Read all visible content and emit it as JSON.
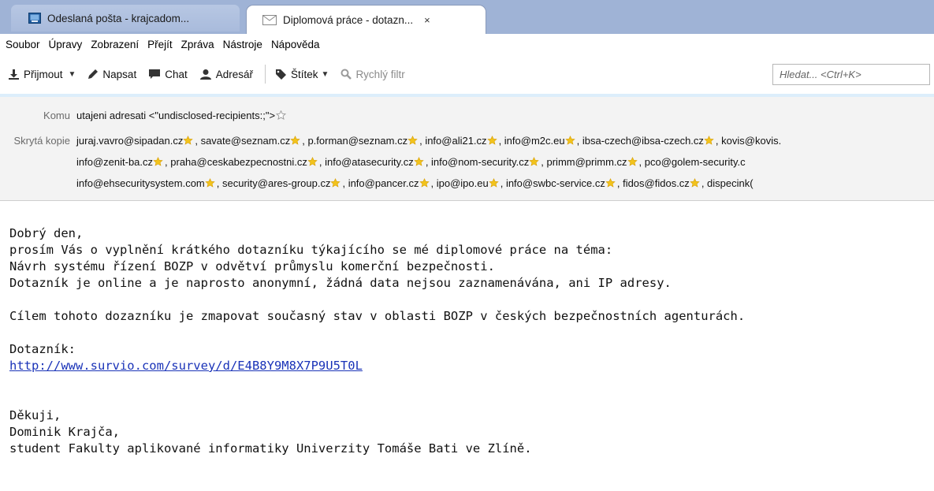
{
  "tabs": [
    {
      "label": "Odeslaná pošta - krajcadom...",
      "icon": "inbox-icon",
      "active": false
    },
    {
      "label": "Diplomová práce - dotazn...",
      "icon": "envelope-icon",
      "active": true,
      "close": "×"
    }
  ],
  "menu": [
    {
      "label": "Soubor"
    },
    {
      "label": "Úpravy"
    },
    {
      "label": "Zobrazení"
    },
    {
      "label": "Přejít"
    },
    {
      "label": "Zpráva"
    },
    {
      "label": "Nástroje"
    },
    {
      "label": "Nápověda"
    }
  ],
  "toolbar": {
    "receive": "Přijmout",
    "compose": "Napsat",
    "chat": "Chat",
    "addressbook": "Adresář",
    "tag": "Štítek",
    "quickfilter": "Rychlý filtr",
    "search_placeholder": "Hledat... <Ctrl+K>"
  },
  "header": {
    "to_label": "Komu",
    "to_value": "utajeni adresati <\"undisclosed-recipients:;\">",
    "bcc_label": "Skrytá kopie",
    "bcc_lines": [
      [
        "juraj.vavro@sipadan.cz",
        "savate@seznam.cz",
        "p.forman@seznam.cz",
        "info@ali21.cz",
        "info@m2c.eu",
        "ibsa-czech@ibsa-czech.cz",
        "kovis@kovis."
      ],
      [
        "info@zenit-ba.cz",
        "praha@ceskabezpecnostni.cz",
        "info@atasecurity.cz",
        "info@nom-security.cz",
        "primm@primm.cz",
        "pco@golem-security.c"
      ],
      [
        "info@ehsecuritysystem.com",
        "security@ares-group.cz",
        "info@pancer.cz",
        "ipo@ipo.eu",
        "info@swbc-service.cz",
        "fidos@fidos.cz",
        "dispecink("
      ]
    ]
  },
  "message": {
    "greeting": "Dobrý den,",
    "line1": "prosím Vás o vyplnění krátkého dotazníku týkajícího se mé diplomové práce na téma:",
    "line2": "Návrh systému řízení BOZP v odvětví průmyslu komerční bezpečnosti.",
    "line3": "Dotazník je online a je naprosto anonymní, žádná data nejsou zaznamenávána, ani IP adresy.",
    "line4": "Cílem tohoto dozazníku je zmapovat současný stav v oblasti BOZP v českých bezpečnostních agenturách.",
    "survey_label": "Dotazník:",
    "survey_link": "http://www.survio.com/survey/d/E4B8Y9M8X7P9U5T0L",
    "thanks": "Děkuji,",
    "name": "Dominik Krajča,",
    "signature": "student Fakulty aplikované informatiky Univerzity Tomáše Bati ve Zlíně."
  },
  "colors": {
    "tabstrip": "#9fb3d6",
    "link": "#1a33b8",
    "header_bg": "#f3f3f3",
    "star": "#f2c31c"
  }
}
